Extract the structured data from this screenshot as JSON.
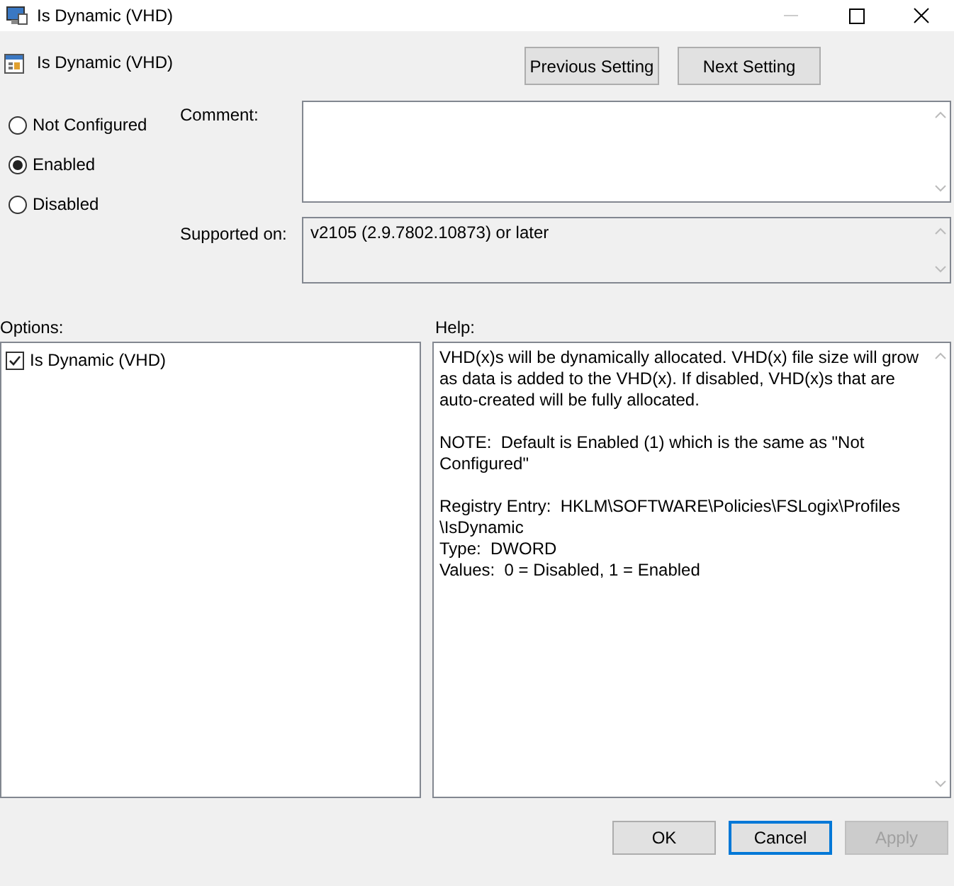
{
  "window": {
    "title": "Is Dynamic (VHD)"
  },
  "setting_title": "Is Dynamic (VHD)",
  "nav_buttons": [
    {
      "label": "Previous Setting"
    },
    {
      "label": "Next Setting"
    }
  ],
  "states": [
    {
      "label": "Not Configured",
      "selected": false
    },
    {
      "label": "Enabled",
      "selected": true
    },
    {
      "label": "Disabled",
      "selected": false
    }
  ],
  "comment": {
    "label": "Comment:"
  },
  "supported_on": {
    "label": "Supported on:",
    "value": "v2105 (2.9.7802.10873) or later"
  },
  "options": {
    "label": "Options:",
    "items": [
      {
        "label": "Is Dynamic (VHD)",
        "checked": true
      }
    ]
  },
  "help": {
    "label": "Help:",
    "paragraphs": [
      [
        "VHD(x)s will be dynamically allocated. VHD(x) file size will grow",
        "as data is added to the VHD(x). If disabled, VHD(x)s that are",
        "auto-created will be fully allocated."
      ],
      [
        "NOTE:  Default is Enabled (1) which is the same as \"Not",
        "Configured\""
      ],
      [
        "Registry Entry:  HKLM\\SOFTWARE\\Policies\\FSLogix\\Profiles",
        "\\IsDynamic",
        "Type:  DWORD",
        "Values:  0 = Disabled, 1 = Enabled"
      ]
    ]
  },
  "footer_buttons": [
    {
      "label": "OK",
      "focused": false,
      "disabled": false
    },
    {
      "label": "Cancel",
      "focused": true,
      "disabled": false
    },
    {
      "label": "Apply",
      "focused": false,
      "disabled": true
    }
  ]
}
